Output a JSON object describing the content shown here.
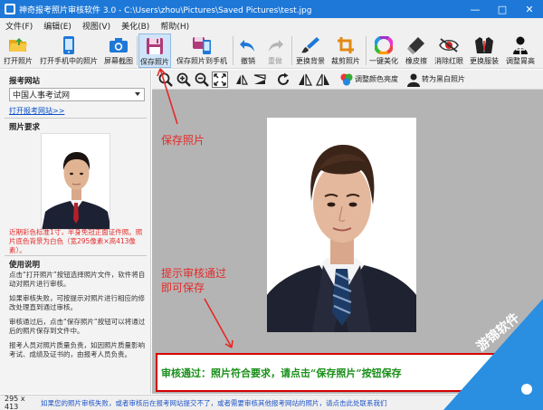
{
  "window": {
    "title": "神奇报考照片审核软件 3.0 - C:\\Users\\zhou\\Pictures\\Saved Pictures\\test.jpg",
    "controls": [
      "—",
      "□",
      "✕"
    ]
  },
  "menu": [
    "文件(F)",
    "编辑(E)",
    "视图(V)",
    "美化(B)",
    "帮助(H)"
  ],
  "toolbar": {
    "open_photo": "打开照片",
    "open_phone": "打开手机中的照片",
    "screenshot": "屏幕截图",
    "save_photo": "保存照片",
    "save_to_phone": "保存照片到手机",
    "undo": "撤销",
    "redo": "重做",
    "change_bg": "更换背景",
    "crop": "裁剪照片",
    "beautify": "一键美化",
    "eraser": "橡皮擦",
    "red_eye": "消除红眼",
    "clothes": "更换服装",
    "adjust_size": "调整胃高"
  },
  "left": {
    "site_title": "报考网站",
    "site_value": "中国人事考试网",
    "site_link": "打开报考网站>>",
    "req_title": "照片要求",
    "req_note": "近期彩色标准1寸，半身免冠正面证件照。照片底色背景为白色（宽295像素×高413像素）。",
    "usage_title": "使用说明",
    "usage": [
      "点击“打开照片”按钮选择照片文件，软件将自动对照片进行审核。",
      "如果审核失败，可按提示对照片进行相应的修改处理直到通过审核。",
      "审核通过后，点击“保存照片”按钮可以将通过后的照片保存到文件中。",
      "报考人员对照片质量负责，如因照片质量影响考试、成绩及证书的，由报考人员负责。"
    ]
  },
  "image_tools": {
    "adjust_color": "调整颜色亮度",
    "to_bw": "转为黑白照片"
  },
  "annotations": {
    "save": "保存照片",
    "hint_line1": "提示审核通过",
    "hint_line2": "即可保存"
  },
  "result_text": "审核通过：照片符合要求，请点击“保存照片”按钮保存",
  "status": {
    "size": "295 x 413",
    "message": "如果您的照片审核失败，或者审核后在报考网站提交不了，或者需要审核其他报考网站的照片，请点击此处联系我们"
  },
  "watermark": "游锦软件",
  "colors": {
    "titlebar": "#1e78d7",
    "accent_red": "#e42a2a",
    "pass_green": "#1a8f1a",
    "link_blue": "#0a50c8"
  }
}
